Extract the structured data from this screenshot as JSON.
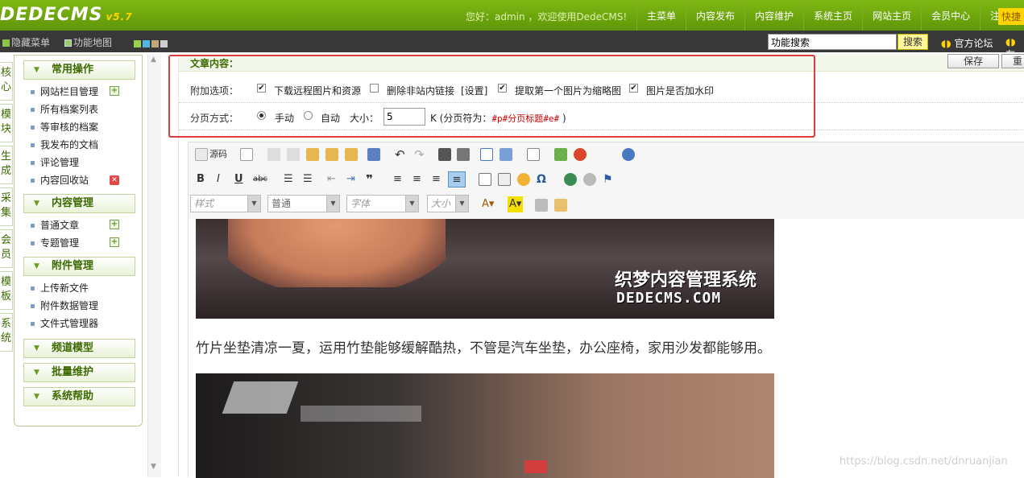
{
  "header": {
    "logo": "DEDECMS",
    "version": "v5.7",
    "welcome": "您好：admin ，欢迎使用DedeCMS!",
    "nav": [
      "主菜单",
      "内容发布",
      "内容维护",
      "系统主页",
      "网站主页",
      "会员中心",
      "注销"
    ],
    "quick": "快捷"
  },
  "subbar": {
    "hide_menu": "隐藏菜单",
    "func_map": "功能地图",
    "search_value": "功能搜索",
    "search_button": "搜索",
    "forum": "官方论坛",
    "forum2": "在"
  },
  "left_tabs": [
    "核心",
    "模块",
    "生成",
    "采集",
    "会员",
    "模板",
    "系统"
  ],
  "menu": {
    "group1": {
      "title": "常用操作",
      "items": [
        "网站栏目管理",
        "所有档案列表",
        "等审核的档案",
        "我发布的文档",
        "评论管理",
        "内容回收站"
      ]
    },
    "group2": {
      "title": "内容管理",
      "items": [
        "普通文章",
        "专题管理"
      ]
    },
    "group3": {
      "title": "附件管理",
      "items": [
        "上传新文件",
        "附件数据管理",
        "文件式管理器"
      ]
    },
    "group4": {
      "title": "频道模型"
    },
    "group5": {
      "title": "批量维护"
    },
    "group6": {
      "title": "系统帮助"
    }
  },
  "article": {
    "header": "文章内容：",
    "save": "保存",
    "reset": "重",
    "extra_label": "附加选项：",
    "opt_remote": "下载远程图片和资源",
    "opt_remove_links": "删除非站内链接",
    "opt_settings": "[设置]",
    "opt_thumb": "提取第一个图片为缩略图",
    "opt_watermark": "图片是否加水印",
    "page_label": "分页方式：",
    "page_manual": "手动",
    "page_auto": "自动",
    "size_label": "大小：",
    "size_value": "5",
    "page_note_prefix": "K (分页符为：",
    "page_token": "#p#分页标题#e#",
    "page_note_suffix": ")"
  },
  "editor": {
    "source": "源码",
    "style_combo": "样式",
    "format_combo": "普通",
    "font_combo": "字体",
    "size_combo": "大小",
    "watermark_title": "织梦内容管理系统",
    "watermark_url": "DEDECMS.COM",
    "paragraph": "竹片坐垫清凉一夏，运用竹垫能够缓解酷热，不管是汽车坐垫，办公座椅，家用沙发都能够用。"
  },
  "footer": {
    "watermark": "https://blog.csdn.net/dnruanjian"
  },
  "colors": {
    "brand_green": "#6aa50e",
    "dark_bar": "#383838",
    "highlight_red": "#e0393e",
    "accent_yellow": "#ffd400"
  }
}
